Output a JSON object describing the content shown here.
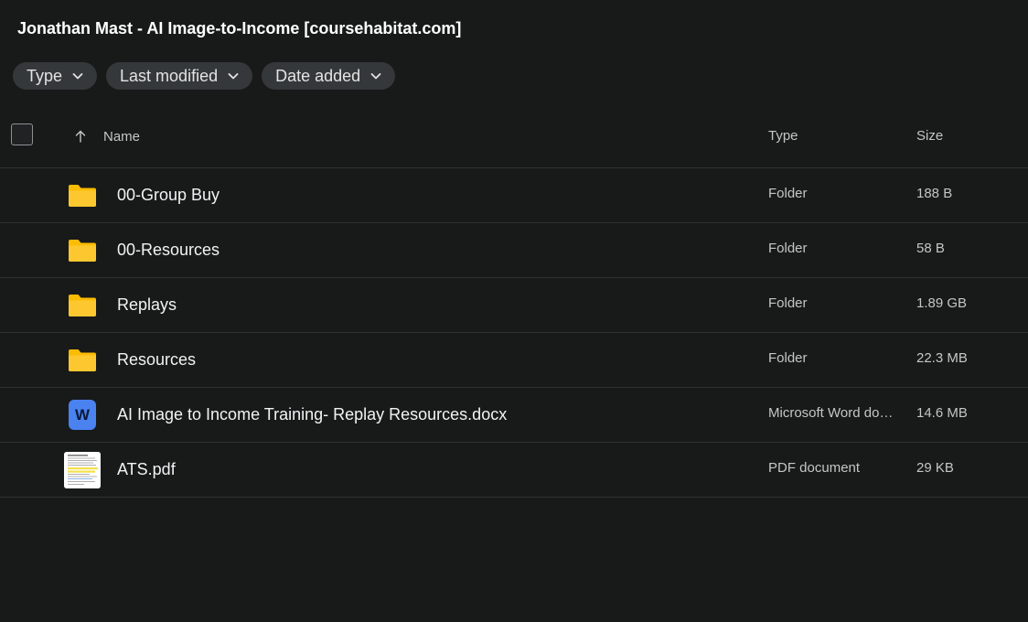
{
  "page": {
    "title": "Jonathan Mast - AI Image-to-Income [coursehabitat.com]"
  },
  "filters": [
    {
      "label": "Type",
      "icon": "chevron-down-icon"
    },
    {
      "label": "Last modified",
      "icon": "chevron-down-icon"
    },
    {
      "label": "Date added",
      "icon": "chevron-down-icon"
    }
  ],
  "table": {
    "columns": {
      "name": "Name",
      "type": "Type",
      "size": "Size"
    },
    "sort_icon": "arrow-up-icon",
    "rows": [
      {
        "icon": "folder-icon",
        "name": "00-Group Buy",
        "type": "Folder",
        "size": "188 B"
      },
      {
        "icon": "folder-icon",
        "name": "00-Resources",
        "type": "Folder",
        "size": "58 B"
      },
      {
        "icon": "folder-icon",
        "name": "Replays",
        "type": "Folder",
        "size": "1.89 GB"
      },
      {
        "icon": "folder-icon",
        "name": "Resources",
        "type": "Folder",
        "size": "22.3 MB"
      },
      {
        "icon": "word-document-icon",
        "name": "AI Image to Income Training- Replay Resources.docx",
        "type": "Microsoft Word document",
        "size": "14.6 MB",
        "icon_letter": "W"
      },
      {
        "icon": "pdf-thumbnail-icon",
        "name": "ATS.pdf",
        "type": "PDF document",
        "size": "29 KB"
      }
    ]
  },
  "colors": {
    "background": "#181919",
    "folder": "#fbbc04",
    "word": "#4a82f0",
    "chip": "#35383a"
  }
}
